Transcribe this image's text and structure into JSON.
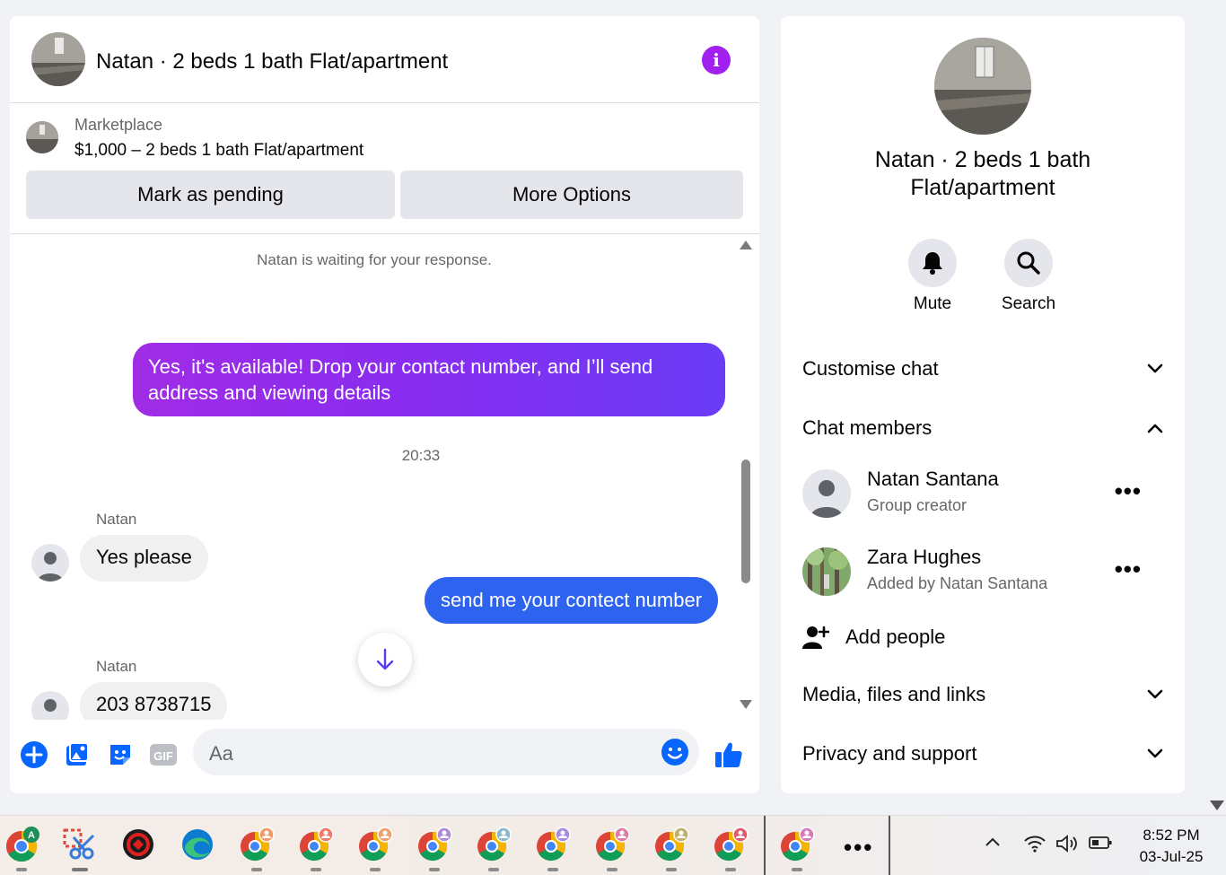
{
  "chat": {
    "title": "Natan · 2 beds 1 bath Flat/apartment",
    "info_icon": "info-icon",
    "listing": {
      "source": "Marketplace",
      "title": "$1,000 – 2 beds 1 bath Flat/apartment",
      "mark_pending_label": "Mark as pending",
      "more_options_label": "More Options"
    },
    "waiting_text": "Natan is waiting for your response.",
    "messages": [
      {
        "direction": "outgoing",
        "text": "Yes, it's available! Drop your contact number, and I’ll send address and viewing details"
      },
      {
        "direction": "timestamp",
        "text": "20:33"
      },
      {
        "direction": "incoming",
        "sender": "Natan",
        "text": "Yes please"
      },
      {
        "direction": "outgoing",
        "text": "send me your contect number"
      },
      {
        "direction": "incoming",
        "sender": "Natan",
        "text": "203 8738715"
      }
    ],
    "composer": {
      "placeholder": "Aa",
      "icons": [
        "plus-icon",
        "photo-icon",
        "sticker-icon",
        "gif-icon",
        "emoji-icon",
        "thumbs-up-icon"
      ],
      "gif_label": "GIF"
    }
  },
  "info_panel": {
    "title": "Natan · 2 beds 1 bath Flat/apartment",
    "actions": [
      {
        "label": "Mute",
        "icon": "bell-icon"
      },
      {
        "label": "Search",
        "icon": "search-icon"
      }
    ],
    "sections": {
      "customise": "Customise chat",
      "members": "Chat members",
      "media": "Media, files and links",
      "privacy": "Privacy and support"
    },
    "members": [
      {
        "name": "Natan Santana",
        "subtitle": "Group creator"
      },
      {
        "name": "Zara Hughes",
        "subtitle": "Added by Natan Santana"
      }
    ],
    "add_people": "Add people"
  },
  "taskbar": {
    "apps": [
      "chrome-icon",
      "snipping-tool-icon",
      "app-red-icon",
      "edge-icon",
      "chrome-profile-icon",
      "chrome-profile-icon",
      "chrome-profile-icon",
      "chrome-profile-icon",
      "chrome-profile-icon",
      "chrome-profile-icon",
      "chrome-profile-icon",
      "chrome-profile-icon",
      "chrome-profile-icon",
      "chrome-profile-icon"
    ],
    "chrome_badge": "A",
    "more": "...",
    "time": "8:52 PM",
    "date": "03-Jul-25"
  },
  "colors": {
    "accent_purple": "#a020f0",
    "outgoing_gradient_start": "#a02ce6",
    "outgoing_gradient_end": "#6a3cf6",
    "outgoing_blue": "#2e63f0",
    "messenger_blue": "#0866ff"
  }
}
